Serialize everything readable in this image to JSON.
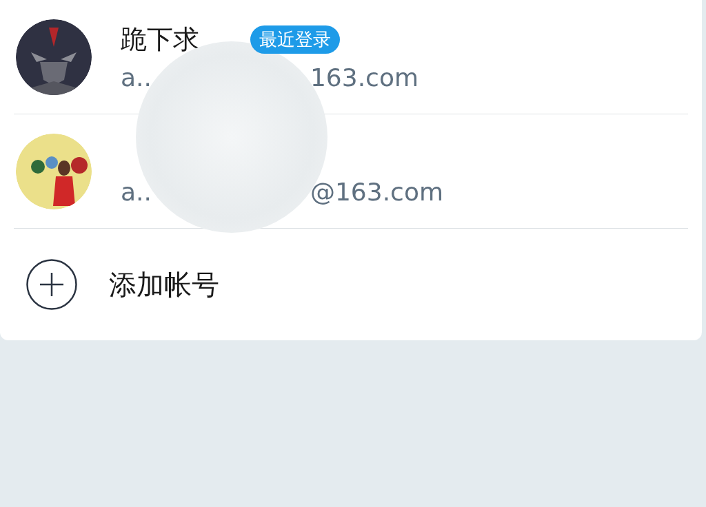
{
  "accounts": [
    {
      "name": "跪下求",
      "badge": "最近登录",
      "email_start": "a..",
      "email_end": "163.com"
    },
    {
      "email_start": "a..",
      "email_end": "@163.com"
    }
  ],
  "add_account": {
    "label": "添加帐号"
  }
}
